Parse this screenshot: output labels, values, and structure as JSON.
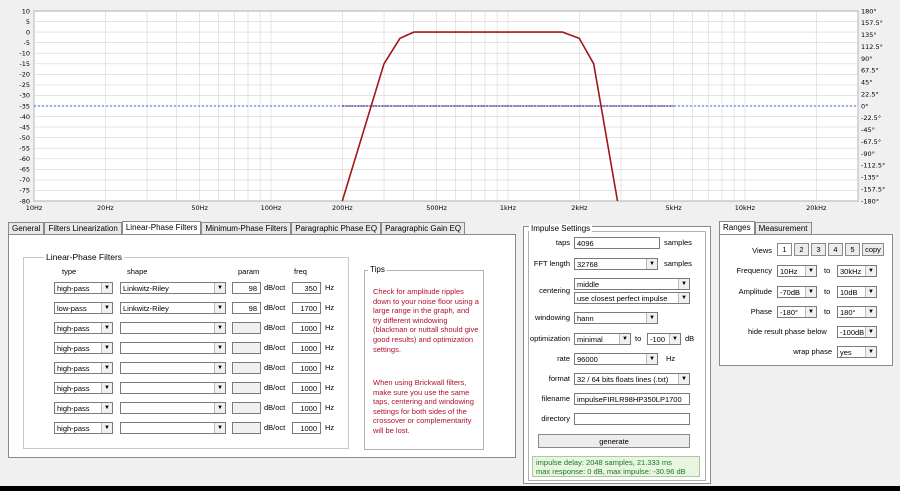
{
  "graph": {
    "y_ticks_db": [
      "10",
      "5",
      "0",
      "-5",
      "-10",
      "-15",
      "-20",
      "-25",
      "-30",
      "-35",
      "-40",
      "-45",
      "-50",
      "-55",
      "-60",
      "-65",
      "-70",
      "-75",
      "-80"
    ],
    "y_ticks_phase": [
      "180°",
      "157.5°",
      "135°",
      "112.5°",
      "90°",
      "67.5°",
      "45°",
      "22.5°",
      "0°",
      "-22.5°",
      "-45°",
      "-67.5°",
      "-90°",
      "-112.5°",
      "-135°",
      "-157.5°",
      "-180°"
    ],
    "x_ticks": [
      "10Hz",
      "20Hz",
      "50Hz",
      "100Hz",
      "200Hz",
      "500Hz",
      "1kHz",
      "2kHz",
      "5kHz",
      "10kHz",
      "20kHz"
    ],
    "colors": {
      "magnitude": "#a01818",
      "phase": "#5a4a8a",
      "reference": "#3a6ad8",
      "grid": "#d4d4d4"
    }
  },
  "chart_data": {
    "type": "line",
    "x_scale": "log",
    "xlim": [
      10,
      30000
    ],
    "ylim": [
      -80,
      10
    ],
    "ylim_right": [
      -180,
      180
    ],
    "grid": true,
    "series": [
      {
        "x": [
          200,
          300,
          350,
          400,
          1000,
          1700,
          2000,
          2300,
          2900
        ],
        "y": [
          -80,
          -15,
          -3,
          0,
          0,
          0,
          -3,
          -15,
          -80
        ]
      }
    ]
  },
  "main_tabs": [
    {
      "label": "General",
      "active": false
    },
    {
      "label": "Filters Linearization",
      "active": false
    },
    {
      "label": "Linear-Phase Filters",
      "active": true
    },
    {
      "label": "Minimum-Phase Filters",
      "active": false
    },
    {
      "label": "Paragraphic Phase EQ",
      "active": false
    },
    {
      "label": "Paragraphic Gain EQ",
      "active": false
    }
  ],
  "filters": {
    "title": "Linear-Phase Filters",
    "headers": {
      "type": "type",
      "shape": "shape",
      "param": "param",
      "freq": "freq"
    },
    "rows": [
      {
        "type": "high-pass",
        "shape": "Linkwitz-Riley",
        "param": "98",
        "param_unit": "dB/oct",
        "freq": "350",
        "freq_unit": "Hz",
        "enabled": true
      },
      {
        "type": "low-pass",
        "shape": "Linkwitz-Riley",
        "param": "98",
        "param_unit": "dB/oct",
        "freq": "1700",
        "freq_unit": "Hz",
        "enabled": true
      },
      {
        "type": "high-pass",
        "shape": "",
        "param": "",
        "param_unit": "dB/oct",
        "freq": "1000",
        "freq_unit": "Hz",
        "enabled": false
      },
      {
        "type": "high-pass",
        "shape": "",
        "param": "",
        "param_unit": "dB/oct",
        "freq": "1000",
        "freq_unit": "Hz",
        "enabled": false
      },
      {
        "type": "high-pass",
        "shape": "",
        "param": "",
        "param_unit": "dB/oct",
        "freq": "1000",
        "freq_unit": "Hz",
        "enabled": false
      },
      {
        "type": "high-pass",
        "shape": "",
        "param": "",
        "param_unit": "dB/oct",
        "freq": "1000",
        "freq_unit": "Hz",
        "enabled": false
      },
      {
        "type": "high-pass",
        "shape": "",
        "param": "",
        "param_unit": "dB/oct",
        "freq": "1000",
        "freq_unit": "Hz",
        "enabled": false
      },
      {
        "type": "high-pass",
        "shape": "",
        "param": "",
        "param_unit": "dB/oct",
        "freq": "1000",
        "freq_unit": "Hz",
        "enabled": false
      }
    ]
  },
  "tips": {
    "title": "Tips",
    "p1": "Check for amplitude ripples down to your noise floor using a large range in the graph, and try different windowing (blackman or nuttall should give good results) and optimization settings.",
    "p2": "When using Brickwall filters, make sure you use the same taps, centering and windowing settings for both sides of the crossover or complementarity will be lost."
  },
  "impulse": {
    "title": "Impulse Settings",
    "taps_label": "taps",
    "taps": "4096",
    "taps_unit": "samples",
    "fft_label": "FFT length",
    "fft": "32768",
    "fft_unit": "samples",
    "centering_label": "centering",
    "centering": "middle",
    "centering2": "use closest perfect impulse",
    "windowing_label": "windowing",
    "windowing": "hann",
    "optimization_label": "optimization",
    "optimization": "minimal",
    "opt_to": "to",
    "opt_value": "-100",
    "opt_unit": "dB",
    "rate_label": "rate",
    "rate": "96000",
    "rate_unit": "Hz",
    "format_label": "format",
    "format": "32 / 64 bits floats lines (.txt)",
    "filename_label": "filename",
    "filename": "impulseFIRLR98HP350LP1700",
    "directory_label": "directory",
    "directory": "",
    "generate": "generate",
    "status1": "impulse delay: 2048 samples, 21.333 ms",
    "status2": "max response: 0 dB, max impulse: -30.96 dB"
  },
  "ranges_tabs": [
    {
      "label": "Ranges",
      "active": true
    },
    {
      "label": "Measurement",
      "active": false
    }
  ],
  "ranges": {
    "views_label": "Views",
    "views": [
      "1",
      "2",
      "3",
      "4",
      "5"
    ],
    "copy": "copy",
    "frequency_label": "Frequency",
    "freq_from": "10Hz",
    "to": "to",
    "freq_to": "30kHz",
    "amplitude_label": "Amplitude",
    "amp_from": "-70dB",
    "amp_to": "10dB",
    "phase_label": "Phase",
    "phase_from": "-180°",
    "phase_to": "180°",
    "hide_label": "hide result phase below",
    "hide_value": "-100dB",
    "wrap_label": "wrap phase",
    "wrap_value": "yes"
  }
}
